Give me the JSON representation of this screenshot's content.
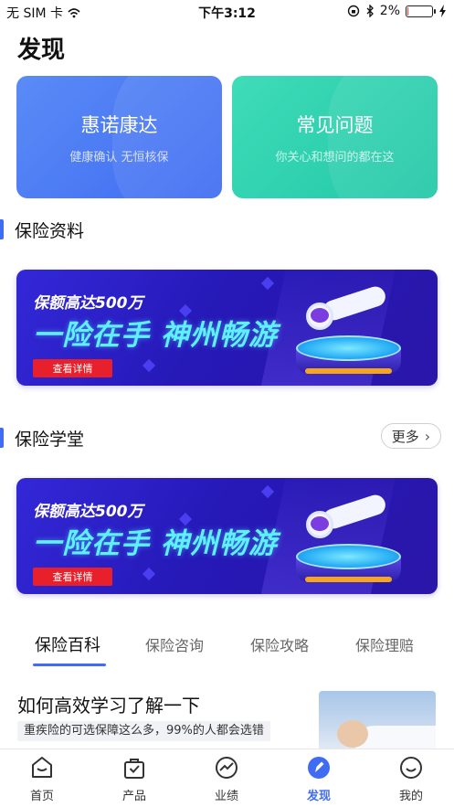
{
  "status_bar": {
    "carrier": "无 SIM 卡",
    "time": "下午3:12",
    "battery_percent": "2%",
    "battery_level": 0.02
  },
  "page": {
    "title": "发现"
  },
  "feature_cards": [
    {
      "title": "惠诺康达",
      "subtitle": "健康确认 无恒核保",
      "color": "#4a78f4"
    },
    {
      "title": "常见问题",
      "subtitle": "你关心和想问的都在这",
      "color": "#2ccfae"
    }
  ],
  "sections": {
    "materials": {
      "title": "保险资料"
    },
    "academy": {
      "title": "保险学堂",
      "more_label": "更多"
    }
  },
  "banners": [
    {
      "line1": "保额高达500万",
      "line2": "一险在手 神州畅游",
      "button": "查看详情"
    },
    {
      "line1": "保额高达500万",
      "line2": "一险在手 神州畅游",
      "button": "查看详情"
    }
  ],
  "tabs": [
    {
      "label": "保险百科",
      "active": true
    },
    {
      "label": "保险咨询",
      "active": false
    },
    {
      "label": "保险攻略",
      "active": false
    },
    {
      "label": "保险理赔",
      "active": false
    }
  ],
  "article": {
    "title": "如何高效学习了解一下",
    "tag": "重疾险的可选保障这么多，99%的人都会选错"
  },
  "bottom_nav": [
    {
      "label": "首页",
      "icon": "home-icon",
      "active": false
    },
    {
      "label": "产品",
      "icon": "product-bag-icon",
      "active": false
    },
    {
      "label": "业绩",
      "icon": "performance-chart-icon",
      "active": false
    },
    {
      "label": "发现",
      "icon": "discover-compass-icon",
      "active": true
    },
    {
      "label": "我的",
      "icon": "profile-icon",
      "active": false
    }
  ],
  "colors": {
    "accent": "#3f6cf2",
    "banner_button": "#e8202b",
    "battery_low": "#e53935"
  }
}
